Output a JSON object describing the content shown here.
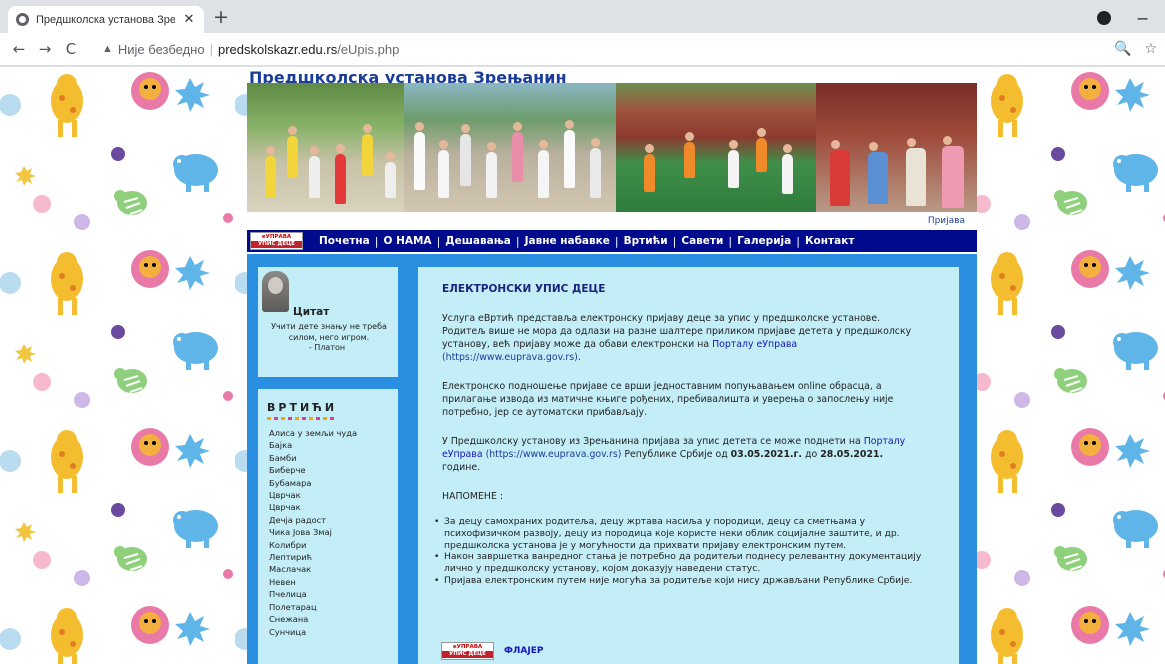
{
  "browser": {
    "tab_title": "Предшколска установа Зрењан",
    "new_tab": "+",
    "back": "←",
    "forward": "→",
    "reload": "C",
    "not_secure": "Није безбедно",
    "separator": "|",
    "url_host": "predskolskazr.edu.rs",
    "url_path": "/eUpis.php",
    "zoom_icon": "🔍",
    "star_icon": "☆",
    "minimize": "−",
    "close_tab": "✕"
  },
  "site": {
    "title": "Предшколска установа Зрењанин",
    "login": "Пријава",
    "logo_top": "eУПРАВА",
    "logo_bottom": "УПИС ДЕЦЕ",
    "nav": [
      "Почетна",
      "О НАМА",
      "Дешавања",
      "Јавне набавке",
      "Вртићи",
      "Савети",
      "Галерија",
      "Контакт"
    ]
  },
  "quote": {
    "title": "Цитат",
    "text": "Учити дете знању не треба силом, него игром.",
    "author": "- Платон"
  },
  "kindergartens": {
    "title": "ВРТИЋИ",
    "items": [
      "Алиса у земљи чуда",
      "Бајка",
      "Бамби",
      "Биберче",
      "Бубамара",
      "Цврчак",
      "Цврчак",
      "Дечја радост",
      "Чика Јова Змај",
      "Колибри",
      "Лептирић",
      "Маслачак",
      "Невен",
      "Пчелица",
      "Полетарац",
      "Снежана",
      "Сунчица"
    ]
  },
  "main": {
    "title": "ЕЛЕКТРОНСКИ УПИС ДЕЦЕ",
    "p1_text": "Услуга еВртић представља електронску пријаву деце за упис у предшколске установе. Родитељ више не мора да одлази на разне шалтере приликом пријаве детета у предшколску установу, већ пријаву може да обави електронски на ",
    "p1_link": "Порталу еУправа",
    "p1_url": "(https://www.euprava.gov.rs)",
    "p1_end": ".",
    "p2_text": "Електронско подношење пријаве се врши једноставним попуњавањем online обрасца, а прилагање извода из матичне књиге рођених, пребивалишта и уверења о запослењу није потребно, јер се аутоматски прибављају.",
    "p3_text": "У Предшколску установу из Зрењанина пријава за упис детета се може поднети на ",
    "p3_link": "Порталу еУправа",
    "p3_url": "(https://www.euprava.gov.rs)",
    "p3_mid": " Републике Србије од ",
    "p3_date1": "03.05.2021.г.",
    "p3_do": " до ",
    "p3_date2": "28.05.2021.",
    "p3_end": " године.",
    "notes_title": "НАПОМЕНЕ :",
    "notes": [
      "За децу самохраних родитеља, децу жртава насиља у породици, децу са сметњама у психофизичком развоју, децу из породица које користе неки облик социјалне заштите, и др. предшколска установа је у могућности да прихвати пријаву електронским путем.",
      "Након завршетка ванредног стања је потребно да родитељи поднесу релевантну документацију лично у предшколску установу, којом доказују наведени статус.",
      "Пријава електронским путем није могућа за родитеље који нису држављани Републике Србије."
    ],
    "flyer": "ФЛАЈЕР"
  }
}
